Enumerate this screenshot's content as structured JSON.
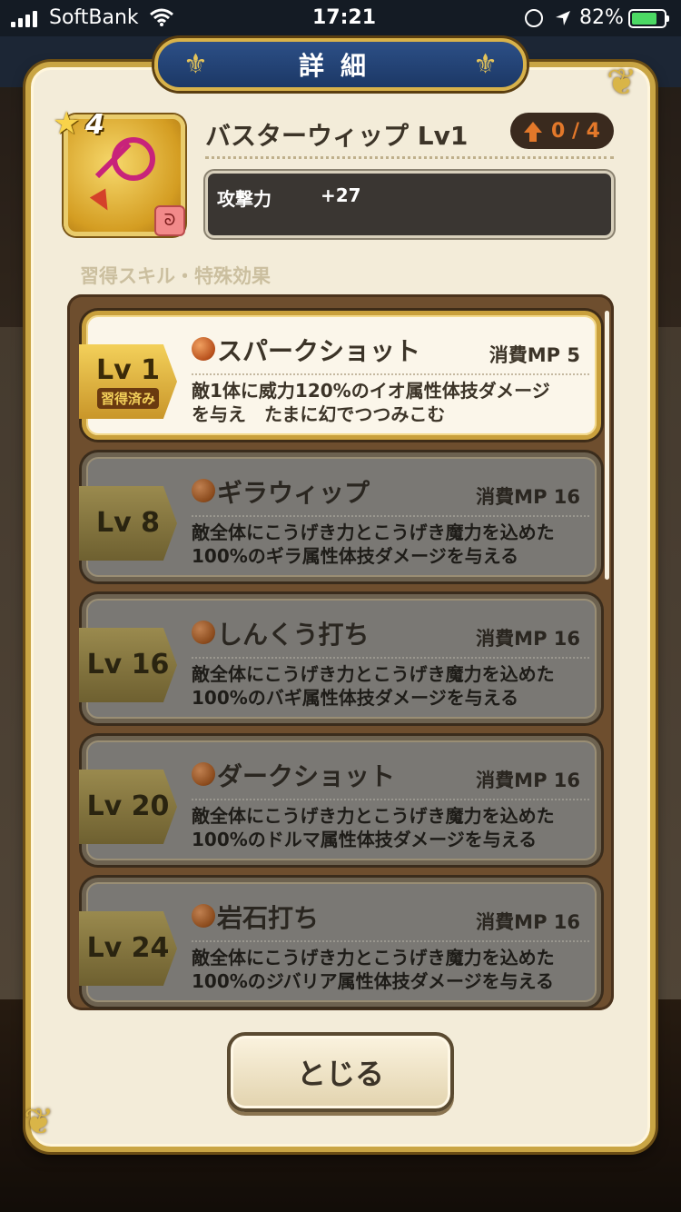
{
  "status_bar": {
    "carrier": "SoftBank",
    "time": "17:21",
    "battery": "82%"
  },
  "dialog": {
    "title": "詳細",
    "close_label": "とじる"
  },
  "item": {
    "stars": "4",
    "name": "バスターウィップ Lv1",
    "upgrade": "0 / 4",
    "stat_label": "攻撃力",
    "stat_value": "+27",
    "icon": "whip-icon",
    "type_icon": "whip-type-icon"
  },
  "section_label": "習得スキル・特殊効果",
  "skills": [
    {
      "level": "Lv 1",
      "learned_mark": "習得済み",
      "name": "スパークショット",
      "mp": "消費MP  5",
      "desc_1": "敵1体に威力120%のイオ属性体技ダメージ",
      "desc_2": "を与え　たまに幻でつつみこむ",
      "state": "learned"
    },
    {
      "level": "Lv 8",
      "learned_mark": "",
      "name": "ギラウィップ",
      "mp": "消費MP 16",
      "desc_1": "敵全体にこうげき力とこうげき魔力を込めた",
      "desc_2": "100%のギラ属性体技ダメージを与える",
      "state": "locked"
    },
    {
      "level": "Lv 16",
      "learned_mark": "",
      "name": "しんくう打ち",
      "mp": "消費MP 16",
      "desc_1": "敵全体にこうげき力とこうげき魔力を込めた",
      "desc_2": "100%のバギ属性体技ダメージを与える",
      "state": "locked"
    },
    {
      "level": "Lv 20",
      "learned_mark": "",
      "name": "ダークショット",
      "mp": "消費MP 16",
      "desc_1": "敵全体にこうげき力とこうげき魔力を込めた",
      "desc_2": "100%のドルマ属性体技ダメージを与える",
      "state": "locked"
    },
    {
      "level": "Lv 24",
      "learned_mark": "",
      "name": "岩石打ち",
      "mp": "消費MP 16",
      "desc_1": "敵全体にこうげき力とこうげき魔力を込めた",
      "desc_2": "100%のジバリア属性体技ダメージを与える",
      "state": "locked"
    }
  ],
  "colors": {
    "gold": "#c9a544",
    "title_blue": "#1c3866",
    "upgrade_orange": "#e3782a",
    "panel_brown": "#6e4e2e"
  }
}
